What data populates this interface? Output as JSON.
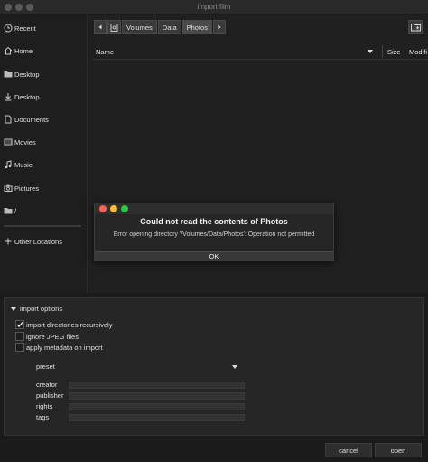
{
  "window": {
    "title": "import film"
  },
  "sidebar": {
    "items": [
      {
        "label": "Recent",
        "icon": "clock-icon"
      },
      {
        "label": "Home",
        "icon": "home-icon"
      },
      {
        "label": "Desktop",
        "icon": "folder-icon"
      },
      {
        "label": "Desktop",
        "icon": "download-icon"
      },
      {
        "label": "Documents",
        "icon": "document-icon"
      },
      {
        "label": "Movies",
        "icon": "film-icon"
      },
      {
        "label": "Music",
        "icon": "music-icon"
      },
      {
        "label": "Pictures",
        "icon": "camera-icon"
      },
      {
        "label": "/",
        "icon": "folder-icon"
      }
    ],
    "other_locations": "Other Locations"
  },
  "pathbar": {
    "segments": [
      "Volumes",
      "Data",
      "Photos"
    ],
    "selected": "Photos"
  },
  "columns": {
    "name": "Name",
    "size": "Size",
    "modified": "Modifi"
  },
  "dialog": {
    "title": "Could not read the contents of Photos",
    "message": "Error opening directory '/Volumes/Data/Photos': Operation not permitted",
    "ok_label": "OK",
    "colors": {
      "close": "#ff5f57",
      "minimize": "#febc2e",
      "maximize": "#28c840"
    }
  },
  "import_options": {
    "header": "import options",
    "checkboxes": [
      {
        "label": "import directories recursively",
        "checked": true
      },
      {
        "label": "ignore JPEG files",
        "checked": false
      },
      {
        "label": "apply metadata on import",
        "checked": false
      }
    ],
    "preset": "preset",
    "fields": [
      {
        "label": "creator",
        "value": ""
      },
      {
        "label": "publisher",
        "value": ""
      },
      {
        "label": "rights",
        "value": ""
      },
      {
        "label": "tags",
        "value": ""
      }
    ]
  },
  "footer": {
    "cancel": "cancel",
    "open": "open"
  }
}
